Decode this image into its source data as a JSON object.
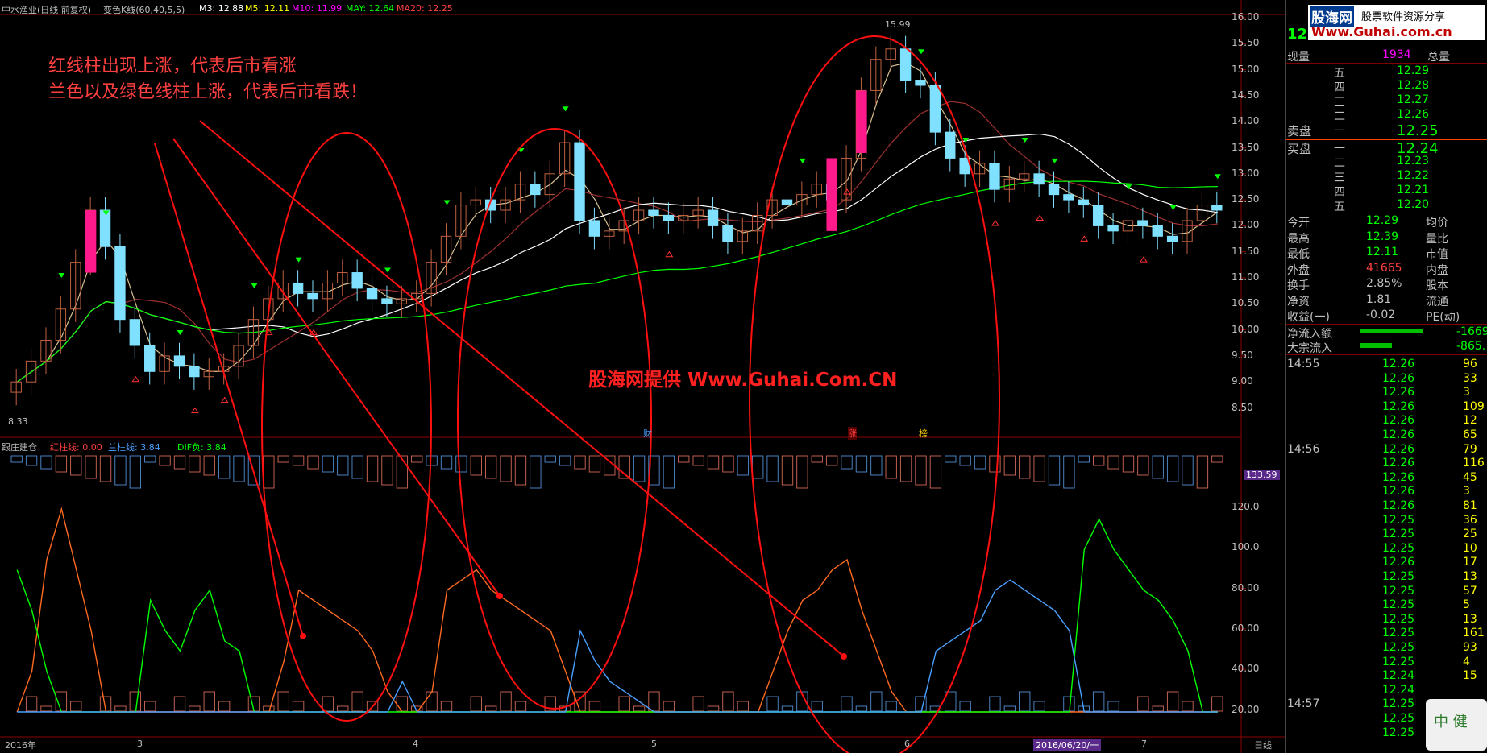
{
  "header": {
    "title": "中水渔业(日线 前复权)",
    "formula": "变色K线(60,40,5,5)",
    "m3": "M3: 12.88",
    "m5": "M5: 12.11",
    "m10": "M10: 11.99",
    "may": "MAY: 12.64",
    "ma20": "MA20: 12.25"
  },
  "colors": {
    "red": "#ff2020",
    "green": "#00ff00",
    "cyan": "#7fe0ff",
    "magenta": "#ff00ff",
    "white": "#ffffff",
    "yellow": "#ffff00",
    "orange": "#ff6a20",
    "blue": "#4aa0ff"
  },
  "price_axis": [
    "16.00",
    "15.50",
    "15.00",
    "14.50",
    "14.00",
    "13.50",
    "13.00",
    "12.50",
    "12.00",
    "11.50",
    "11.00",
    "10.50",
    "10.00",
    "9.50",
    "9.00",
    "8.50"
  ],
  "price_marks": {
    "high": "15.99",
    "low": "8.33"
  },
  "annotations": {
    "line1": "红线柱出现上涨，代表后市看涨",
    "line2": "兰色以及绿色线柱上涨，代表后市看跌！",
    "watermark": "股海网提供 Www.Guhai.Com.CN"
  },
  "event_markers": [
    "财",
    "涨",
    "榜"
  ],
  "indicator": {
    "name": "跟庄建仓",
    "red_line": "红柱线: 0.00",
    "blue_line": "兰柱线: 3.84",
    "dif": "DIF负: 3.84",
    "badge": "133.59",
    "axis": [
      "120.0",
      "100.0",
      "80.00",
      "60.00",
      "40.00",
      "20.00"
    ]
  },
  "dates": {
    "year": "2016年",
    "months": [
      "3",
      "4",
      "5",
      "6",
      "7"
    ],
    "cursor_date": "2016/06/20/一",
    "period": "日线"
  },
  "right_panel": {
    "logo": "股海网",
    "slogan": "股票软件资源分享",
    "url": "Www.Guhai.com.cn",
    "last_price": "12",
    "xianliang_label": "现量",
    "xianliang": "1934",
    "zongliang_label": "总量",
    "asks": [
      {
        "label": "五",
        "price": "12.29"
      },
      {
        "label": "四",
        "price": "12.28"
      },
      {
        "label": "三",
        "price": "12.27"
      },
      {
        "label": "二",
        "price": "12.26"
      },
      {
        "label": "一",
        "price": "12.25"
      }
    ],
    "ask_label": "卖盘",
    "bid_label": "买盘",
    "bids": [
      {
        "label": "一",
        "price": "12.24"
      },
      {
        "label": "二",
        "price": "12.23"
      },
      {
        "label": "三",
        "price": "12.22"
      },
      {
        "label": "四",
        "price": "12.21"
      },
      {
        "label": "五",
        "price": "12.20"
      }
    ],
    "stats": [
      {
        "k": "今开",
        "v": "12.29",
        "k2": "均价"
      },
      {
        "k": "最高",
        "v": "12.39",
        "k2": "量比"
      },
      {
        "k": "最低",
        "v": "12.11",
        "k2": "市值"
      },
      {
        "k": "外盘",
        "v": "41665",
        "k2": "内盘"
      },
      {
        "k": "换手",
        "v": "2.85%",
        "k2": "股本"
      },
      {
        "k": "净资",
        "v": "1.81",
        "k2": "流通"
      },
      {
        "k": "收益(一)",
        "v": "-0.02",
        "k2": "PE(动)"
      }
    ],
    "flows": [
      {
        "k": "净流入额",
        "v": "-1669"
      },
      {
        "k": "大宗流入",
        "v": "-865."
      }
    ],
    "ticks": [
      {
        "t": "14:55",
        "p": "12.26",
        "v": "96"
      },
      {
        "t": "",
        "p": "12.26",
        "v": "33"
      },
      {
        "t": "",
        "p": "12.26",
        "v": "3"
      },
      {
        "t": "",
        "p": "12.26",
        "v": "109"
      },
      {
        "t": "",
        "p": "12.26",
        "v": "12"
      },
      {
        "t": "",
        "p": "12.26",
        "v": "65"
      },
      {
        "t": "14:56",
        "p": "12.26",
        "v": "79"
      },
      {
        "t": "",
        "p": "12.26",
        "v": "116"
      },
      {
        "t": "",
        "p": "12.26",
        "v": "45"
      },
      {
        "t": "",
        "p": "12.26",
        "v": "3"
      },
      {
        "t": "",
        "p": "12.26",
        "v": "81"
      },
      {
        "t": "",
        "p": "12.25",
        "v": "36"
      },
      {
        "t": "",
        "p": "12.25",
        "v": "25"
      },
      {
        "t": "",
        "p": "12.25",
        "v": "10"
      },
      {
        "t": "",
        "p": "12.26",
        "v": "17"
      },
      {
        "t": "",
        "p": "12.25",
        "v": "13"
      },
      {
        "t": "",
        "p": "12.25",
        "v": "57"
      },
      {
        "t": "",
        "p": "12.25",
        "v": "5"
      },
      {
        "t": "",
        "p": "12.25",
        "v": "13"
      },
      {
        "t": "",
        "p": "12.25",
        "v": "161"
      },
      {
        "t": "",
        "p": "12.25",
        "v": "93"
      },
      {
        "t": "",
        "p": "12.25",
        "v": "4"
      },
      {
        "t": "",
        "p": "12.24",
        "v": "15"
      },
      {
        "t": "",
        "p": "12.24",
        "v": ""
      },
      {
        "t": "14:57",
        "p": "12.25",
        "v": ""
      },
      {
        "t": "",
        "p": "12.25",
        "v": ""
      },
      {
        "t": "",
        "p": "12.25",
        "v": ""
      }
    ],
    "mini_logo": "中 健"
  }
}
